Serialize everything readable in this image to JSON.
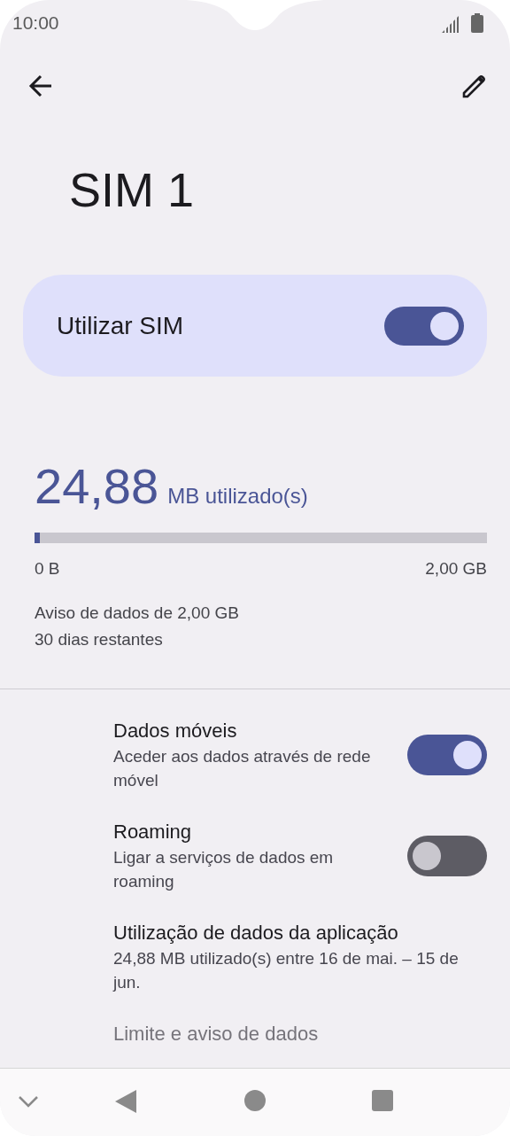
{
  "status_bar": {
    "time": "10:00"
  },
  "toolbar": {
    "title": "SIM 1"
  },
  "use_sim": {
    "label": "Utilizar SIM",
    "on": true
  },
  "usage": {
    "amount": "24,88",
    "unit": "MB utilizado(s)",
    "level": 0.012,
    "min_label": "0 B",
    "max_label": "2,00 GB",
    "warning": "Aviso de dados de 2,00 GB",
    "days_left": "30 dias restantes"
  },
  "settings": [
    {
      "kind": "toggle",
      "title": "Dados móveis",
      "subtitle": "Aceder aos dados através de rede móvel",
      "on": true
    },
    {
      "kind": "toggle",
      "title": "Roaming",
      "subtitle": "Ligar a serviços de dados em roaming",
      "on": false
    },
    {
      "kind": "plain",
      "title": "Utilização de dados da aplicação",
      "subtitle": "24,88 MB utilizado(s) entre 16 de mai. – 15 de jun."
    },
    {
      "kind": "plain",
      "title": "Limite e aviso de dados"
    }
  ]
}
